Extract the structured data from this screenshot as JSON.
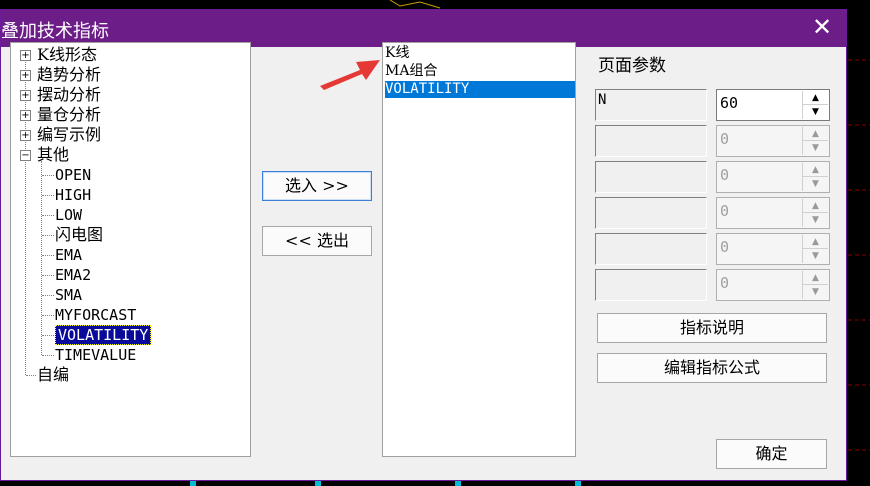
{
  "dialog": {
    "title": "叠加技术指标",
    "close_glyph": "✕"
  },
  "tree": {
    "groups": [
      {
        "expander": "+",
        "label": "K线形态"
      },
      {
        "expander": "+",
        "label": "趋势分析"
      },
      {
        "expander": "+",
        "label": "摆动分析"
      },
      {
        "expander": "+",
        "label": "量仓分析"
      },
      {
        "expander": "+",
        "label": "编写示例"
      },
      {
        "expander": "−",
        "label": "其他"
      }
    ],
    "children": [
      "OPEN",
      "HIGH",
      "LOW",
      "闪电图",
      "EMA",
      "EMA2",
      "SMA",
      "MYFORCAST",
      "VOLATILITY",
      "TIMEVALUE"
    ],
    "selected_child": "VOLATILITY",
    "last": "自编"
  },
  "buttons": {
    "add": "选入 >>",
    "remove": "<< 选出",
    "indicator_desc": "指标说明",
    "edit_formula": "编辑指标公式",
    "ok": "确定"
  },
  "selected_list": {
    "items": [
      "K线",
      "MA组合",
      "VOLATILITY"
    ],
    "selected": "VOLATILITY"
  },
  "params": {
    "title": "页面参数",
    "rows": [
      {
        "name": "N",
        "value": "60"
      },
      {
        "name": "",
        "value": "0"
      },
      {
        "name": "",
        "value": "0"
      },
      {
        "name": "",
        "value": "0"
      },
      {
        "name": "",
        "value": "0"
      },
      {
        "name": "",
        "value": "0"
      }
    ],
    "spin_up": "▲",
    "spin_down": "▼"
  },
  "colors": {
    "titlebar": "#6c1d88",
    "selection": "#0078d7",
    "tree_selection": "#0a0a9a",
    "annotation_arrow": "#e53935"
  }
}
